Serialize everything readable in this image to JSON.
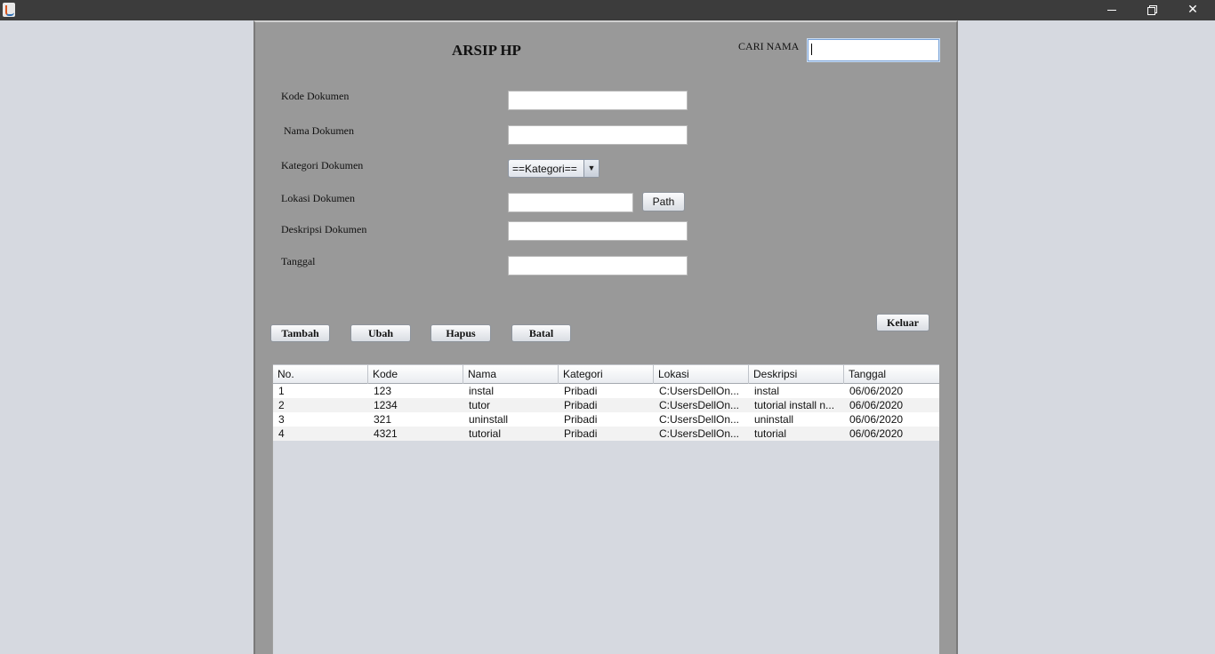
{
  "window": {
    "title": "",
    "minimize": "—",
    "maximize": "❐",
    "close": "✕"
  },
  "form": {
    "title": "ARSIP HP",
    "search_label": "CARI NAMA",
    "search_value": "",
    "labels": {
      "kode": "Kode Dokumen",
      "nama": "Nama Dokumen",
      "kategori": "Kategori Dokumen",
      "lokasi": "Lokasi Dokumen",
      "deskripsi": "Deskripsi Dokumen",
      "tanggal": "Tanggal"
    },
    "values": {
      "kode": "",
      "nama": "",
      "lokasi": "",
      "deskripsi": "",
      "tanggal": ""
    },
    "kategori_selected": "==Kategori==",
    "path_button": "Path"
  },
  "buttons": {
    "tambah": "Tambah",
    "ubah": "Ubah",
    "hapus": "Hapus",
    "batal": "Batal",
    "keluar": "Keluar"
  },
  "table": {
    "columns": [
      "No.",
      "Kode",
      "Nama",
      "Kategori",
      "Lokasi",
      "Deskripsi",
      "Tanggal"
    ],
    "rows": [
      [
        "1",
        "123",
        "instal",
        "Pribadi",
        "C:UsersDellOn...",
        "instal",
        "06/06/2020"
      ],
      [
        "2",
        "1234",
        "tutor",
        "Pribadi",
        "C:UsersDellOn...",
        "tutorial install n...",
        "06/06/2020"
      ],
      [
        "3",
        "321",
        "uninstall",
        "Pribadi",
        "C:UsersDellOn...",
        "uninstall",
        "06/06/2020"
      ],
      [
        "4",
        "4321",
        "tutorial",
        "Pribadi",
        "C:UsersDellOn...",
        "tutorial",
        "06/06/2020"
      ]
    ]
  }
}
